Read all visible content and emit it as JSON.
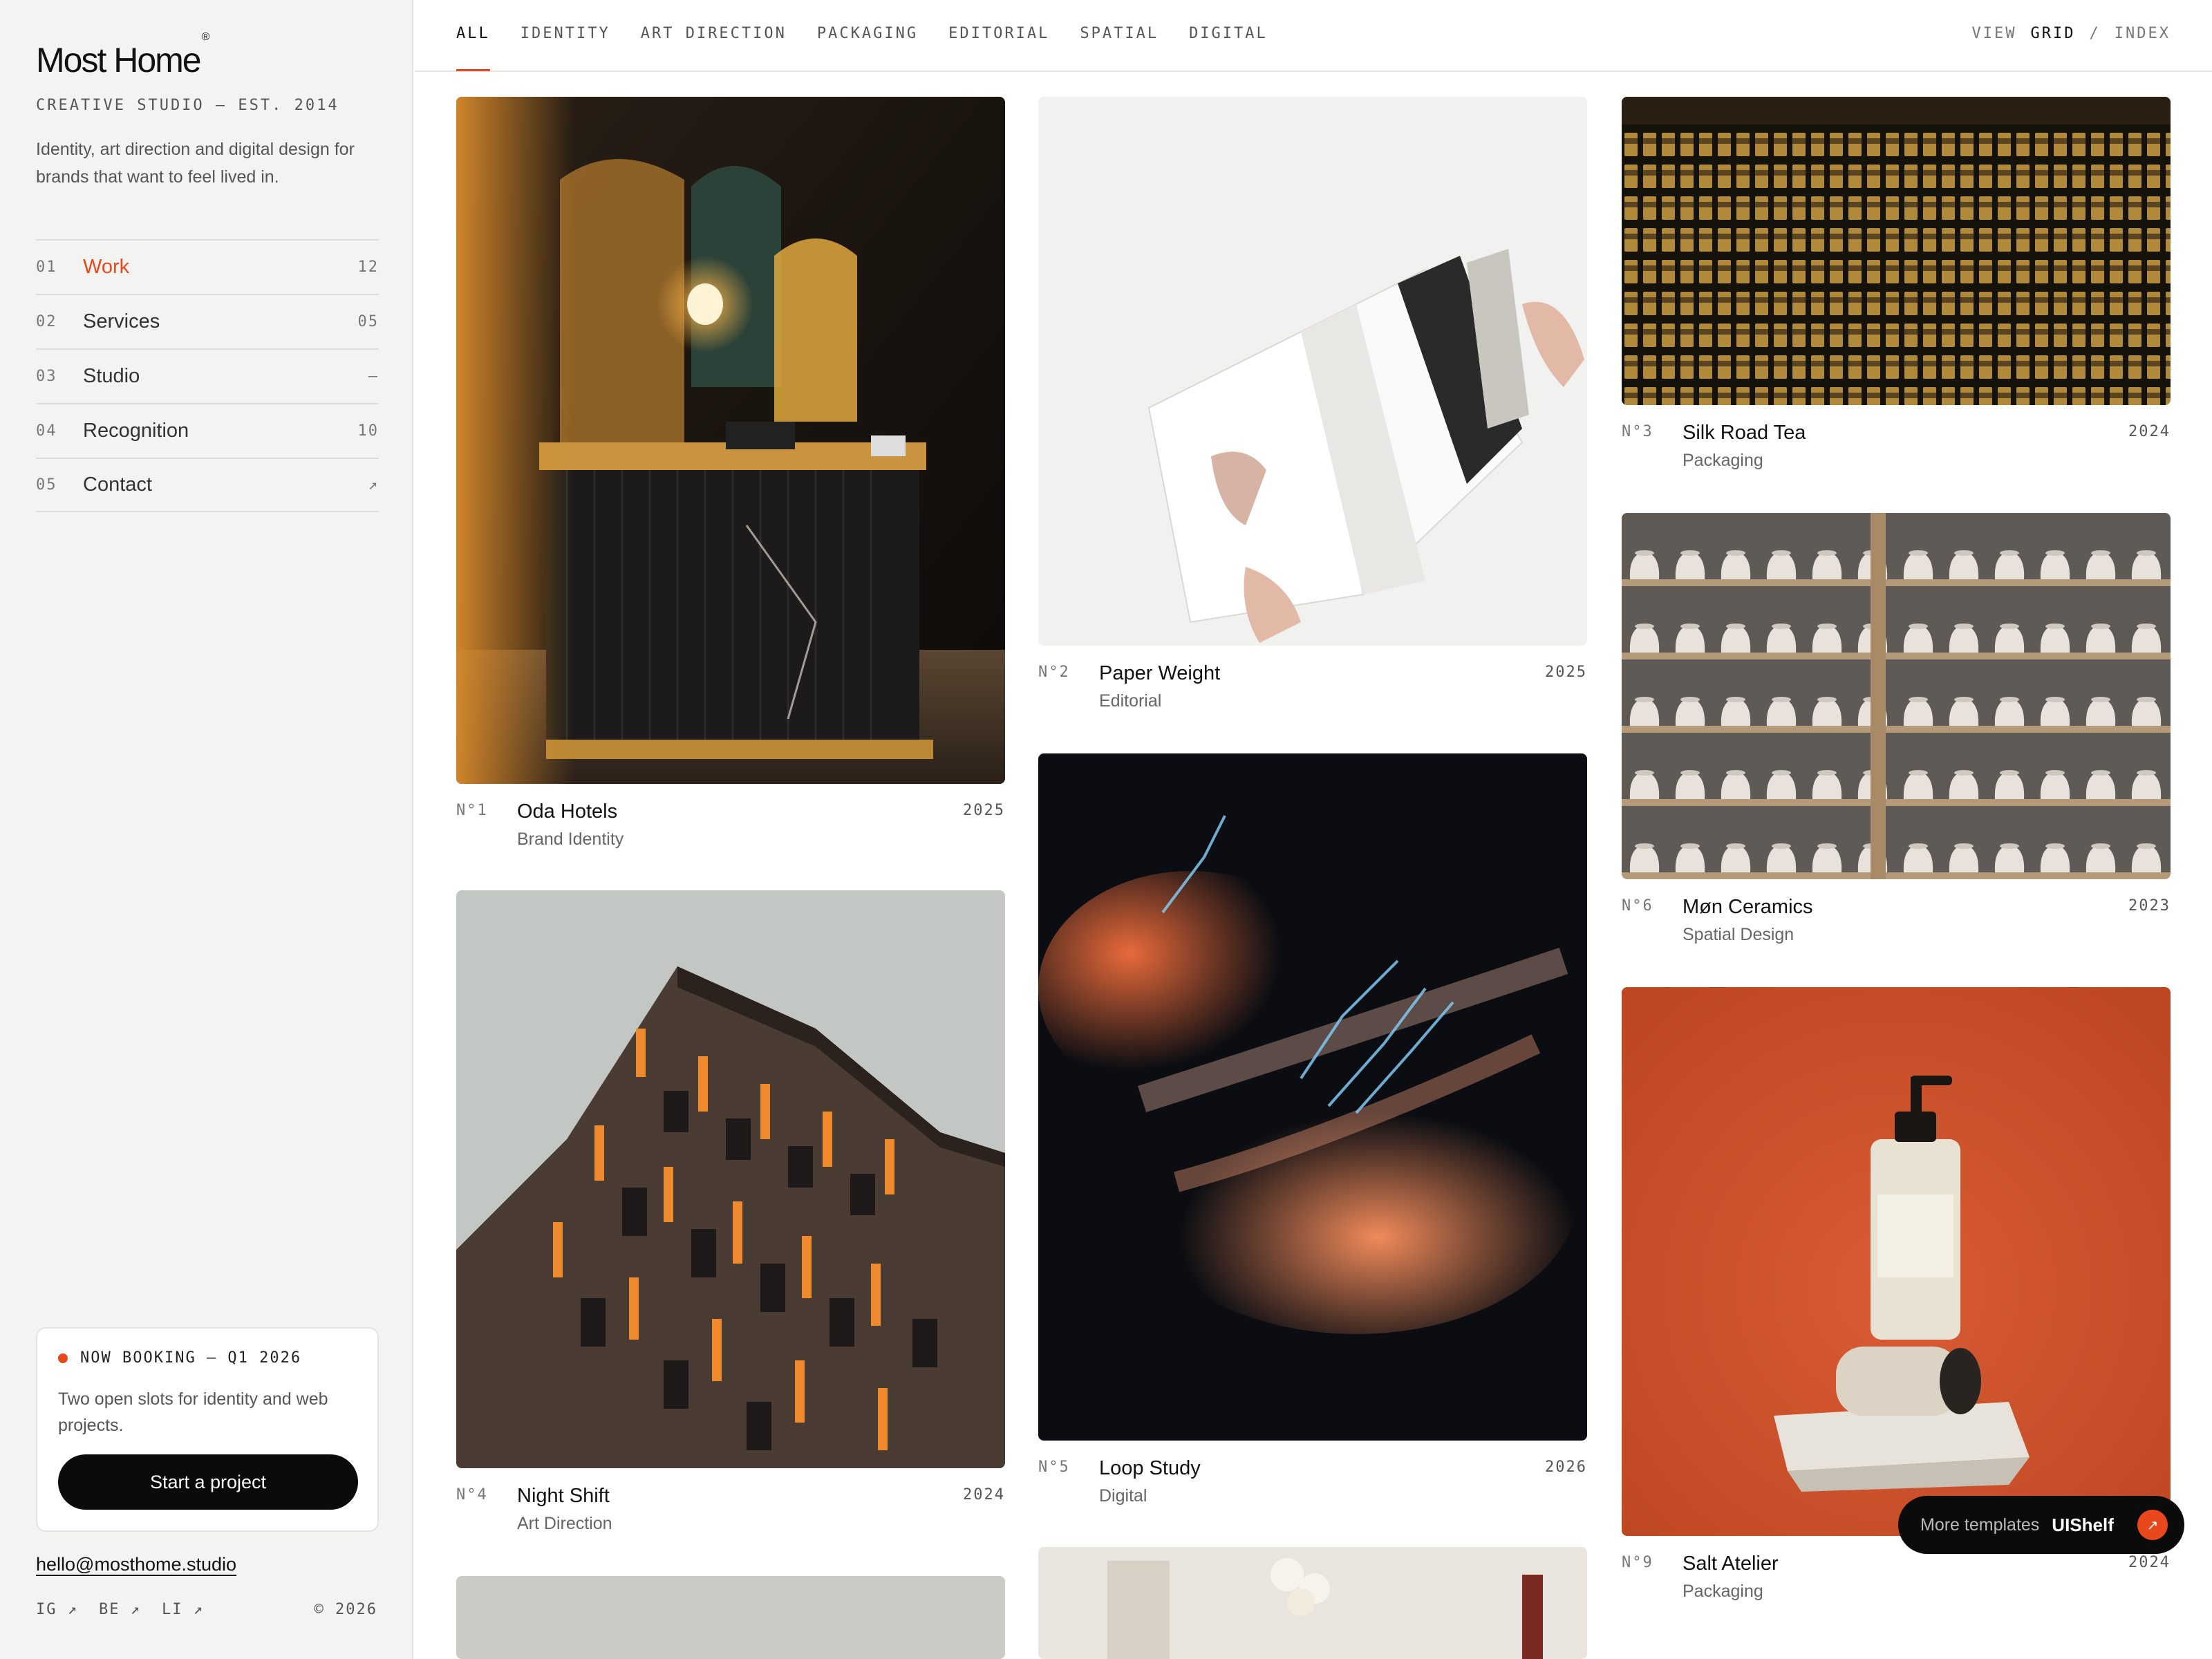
{
  "brand": {
    "name": "Most Home",
    "mark": "®",
    "tagline": "CREATIVE STUDIO — EST. 2014",
    "intro": "Identity, art direction and digital design for brands that want to feel lived in."
  },
  "nav": [
    {
      "num": "01",
      "label": "Work",
      "count": "12",
      "active": true
    },
    {
      "num": "02",
      "label": "Services",
      "count": "05"
    },
    {
      "num": "03",
      "label": "Studio",
      "count": "—"
    },
    {
      "num": "04",
      "label": "Recognition",
      "count": "10"
    },
    {
      "num": "05",
      "label": "Contact",
      "count": "↗"
    }
  ],
  "booking": {
    "status": "NOW BOOKING — Q1 2026",
    "text": "Two open slots for identity and web projects.",
    "cta": "Start a project"
  },
  "footer": {
    "email": "hello@mosthome.studio",
    "socials": [
      "IG ↗",
      "BE ↗",
      "LI ↗"
    ],
    "copyright": "© 2026"
  },
  "filters": [
    "ALL",
    "IDENTITY",
    "ART DIRECTION",
    "PACKAGING",
    "EDITORIAL",
    "SPATIAL",
    "DIGITAL"
  ],
  "view": {
    "label": "VIEW",
    "grid": "GRID",
    "sep": "/",
    "index": "INDEX"
  },
  "projects": [
    {
      "num": "N°1",
      "title": "Oda Hotels",
      "category": "Brand Identity",
      "year": "2025"
    },
    {
      "num": "N°2",
      "title": "Paper Weight",
      "category": "Editorial",
      "year": "2025"
    },
    {
      "num": "N°3",
      "title": "Silk Road Tea",
      "category": "Packaging",
      "year": "2024"
    },
    {
      "num": "N°4",
      "title": "Night Shift",
      "category": "Art Direction",
      "year": "2024"
    },
    {
      "num": "N°5",
      "title": "Loop Study",
      "category": "Digital",
      "year": "2026"
    },
    {
      "num": "N°6",
      "title": "Møn Ceramics",
      "category": "Spatial Design",
      "year": "2023"
    },
    {
      "num": "N°9",
      "title": "Salt Atelier",
      "category": "Packaging",
      "year": "2024"
    }
  ],
  "badge": {
    "prefix": "More templates",
    "brand": "UIShelf",
    "arrow": "↗"
  },
  "colors": {
    "accent": "#e8481c",
    "sidebar": "#f3f3f2",
    "ink": "#111111"
  }
}
